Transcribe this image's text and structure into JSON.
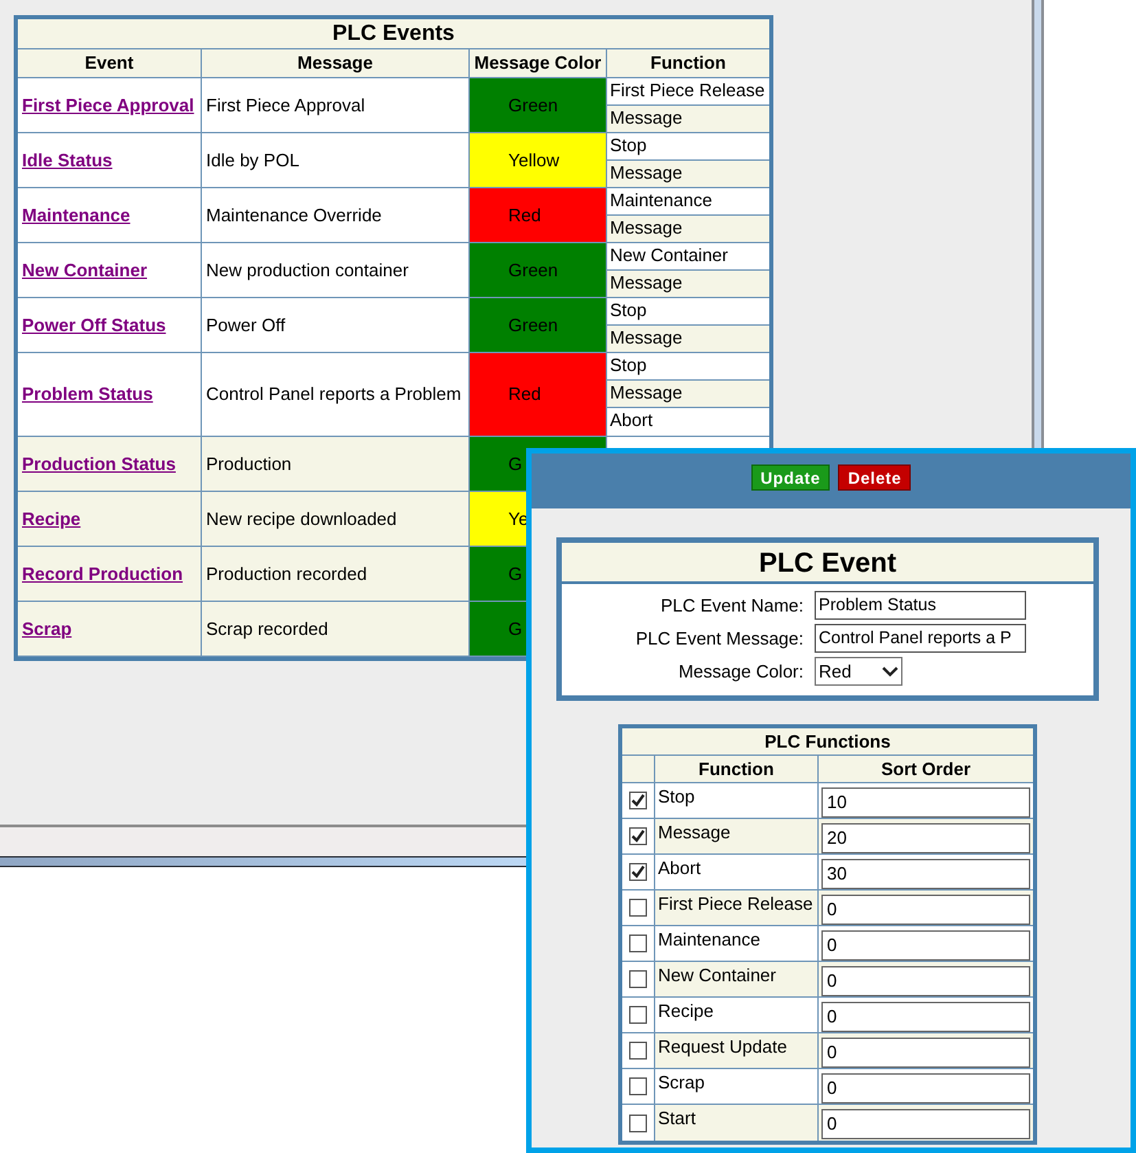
{
  "events_table": {
    "title": "PLC Events",
    "columns": [
      "Event",
      "Message",
      "Message Color",
      "Function"
    ],
    "rows": [
      {
        "event": "First Piece Approval",
        "message": "First Piece Approval",
        "color_label": "Green",
        "color": "#008000",
        "shaded": false,
        "functions": [
          "First Piece Release",
          "Message"
        ]
      },
      {
        "event": "Idle Status",
        "message": "Idle by POL",
        "color_label": "Yellow",
        "color": "#ffff00",
        "shaded": false,
        "functions": [
          "Stop",
          "Message"
        ]
      },
      {
        "event": "Maintenance",
        "message": "Maintenance Override",
        "color_label": "Red",
        "color": "#ff0000",
        "shaded": false,
        "functions": [
          "Maintenance",
          "Message"
        ]
      },
      {
        "event": "New Container",
        "message": "New production container",
        "color_label": "Green",
        "color": "#008000",
        "shaded": false,
        "functions": [
          "New Container",
          "Message"
        ]
      },
      {
        "event": "Power Off Status",
        "message": "Power Off",
        "color_label": "Green",
        "color": "#008000",
        "shaded": false,
        "functions": [
          "Stop",
          "Message"
        ]
      },
      {
        "event": "Problem Status",
        "message": "Control Panel reports a Problem",
        "color_label": "Red",
        "color": "#ff0000",
        "shaded": false,
        "functions": [
          "Stop",
          "Message",
          "Abort"
        ]
      },
      {
        "event": "Production Status",
        "message": "Production",
        "color_label": "G",
        "color": "#008000",
        "shaded": true,
        "functions": []
      },
      {
        "event": "Recipe",
        "message": "New recipe downloaded",
        "color_label": "Ye",
        "color": "#ffff00",
        "shaded": true,
        "functions": []
      },
      {
        "event": "Record Production",
        "message": "Production recorded",
        "color_label": "G",
        "color": "#008000",
        "shaded": true,
        "functions": []
      },
      {
        "event": "Scrap",
        "message": "Scrap recorded",
        "color_label": "G",
        "color": "#008000",
        "shaded": true,
        "functions": []
      }
    ]
  },
  "dialog": {
    "buttons": [
      {
        "label": "Update",
        "kind": "update"
      },
      {
        "label": "Delete",
        "kind": "delete"
      }
    ],
    "event_form": {
      "title": "PLC Event",
      "fields": [
        {
          "label": "PLC Event Name:",
          "value": "Problem Status",
          "kind": "text"
        },
        {
          "label": "PLC Event Message:",
          "value": "Control Panel reports a P",
          "kind": "text"
        },
        {
          "label": "Message Color:",
          "value": "Red",
          "kind": "select"
        }
      ]
    },
    "functions_table": {
      "title": "PLC Functions",
      "columns": [
        "Function",
        "Sort Order"
      ],
      "rows": [
        {
          "function": "Stop",
          "checked": true,
          "sort_order": "10"
        },
        {
          "function": "Message",
          "checked": true,
          "sort_order": "20"
        },
        {
          "function": "Abort",
          "checked": true,
          "sort_order": "30"
        },
        {
          "function": "First Piece Release",
          "checked": false,
          "sort_order": "0"
        },
        {
          "function": "Maintenance",
          "checked": false,
          "sort_order": "0"
        },
        {
          "function": "New Container",
          "checked": false,
          "sort_order": "0"
        },
        {
          "function": "Recipe",
          "checked": false,
          "sort_order": "0"
        },
        {
          "function": "Request Update",
          "checked": false,
          "sort_order": "0"
        },
        {
          "function": "Scrap",
          "checked": false,
          "sort_order": "0"
        },
        {
          "function": "Start",
          "checked": false,
          "sort_order": "0"
        }
      ]
    }
  }
}
